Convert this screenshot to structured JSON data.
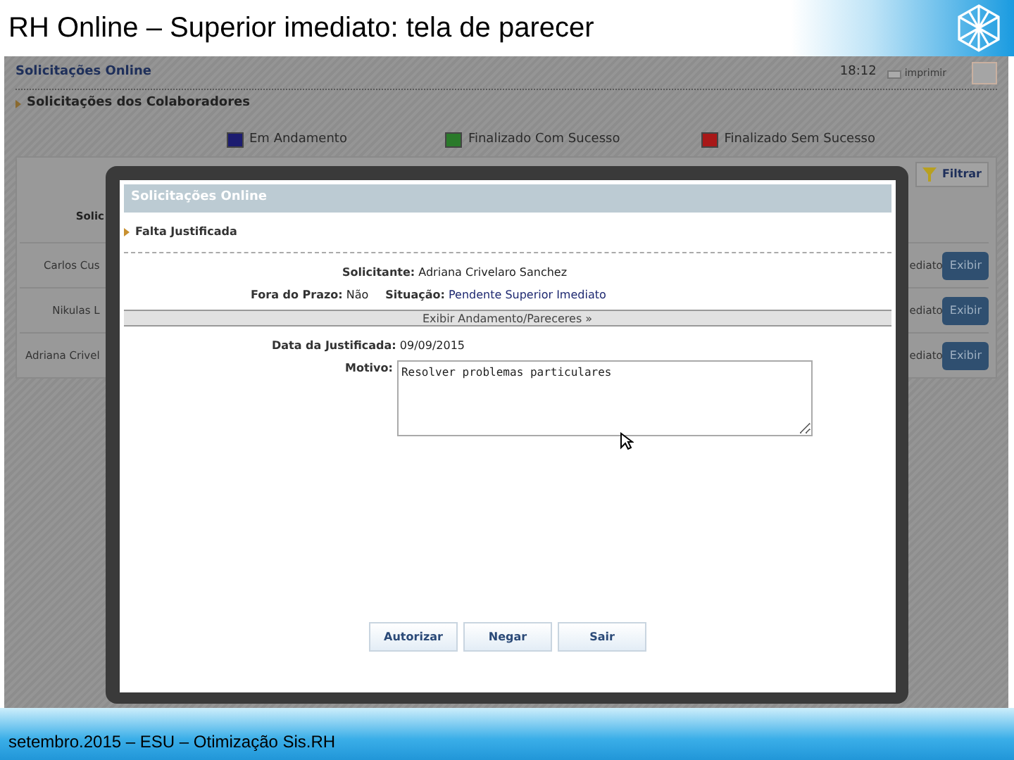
{
  "slide": {
    "title": "RH Online – Superior imediato: tela de parecer",
    "footer": "setembro.2015 – ESU – Otimização Sis.RH"
  },
  "app": {
    "title": "Solicitações Online",
    "time": "18:12",
    "print_label": "imprimir",
    "section": "Solicitações dos Colaboradores",
    "legend": [
      {
        "label": "Em Andamento",
        "color": "#1c1c70"
      },
      {
        "label": "Finalizado Com Sucesso",
        "color": "#2a7a2a"
      },
      {
        "label": "Finalizado Sem Sucesso",
        "color": "#a81818"
      }
    ],
    "filter_button": "Filtrar",
    "table": {
      "columns": [
        "Solic"
      ],
      "rows": [
        {
          "name": "Carlos Cus",
          "status": "ediato",
          "action": "Exibir"
        },
        {
          "name": "Nikulas L",
          "status": "ediato",
          "action": "Exibir"
        },
        {
          "name": "Adriana Crivel",
          "status": "ediato",
          "action": "Exibir"
        }
      ]
    }
  },
  "dialog": {
    "title": "Solicitações Online",
    "section": "Falta Justificada",
    "requester": {
      "label": "Solicitante:",
      "value": "Adriana Crivelaro Sanchez"
    },
    "late": {
      "label": "Fora do Prazo:",
      "value": "Não"
    },
    "situation": {
      "label": "Situação:",
      "value": "Pendente Superior Imediato"
    },
    "history_bar": "Exibir Andamento/Pareceres »",
    "date": {
      "label": "Data da Justificada:",
      "value": "09/09/2015"
    },
    "reason": {
      "label": "Motivo:",
      "value": "Resolver problemas particulares"
    },
    "buttons": [
      "Autorizar",
      "Negar",
      "Sair"
    ]
  }
}
